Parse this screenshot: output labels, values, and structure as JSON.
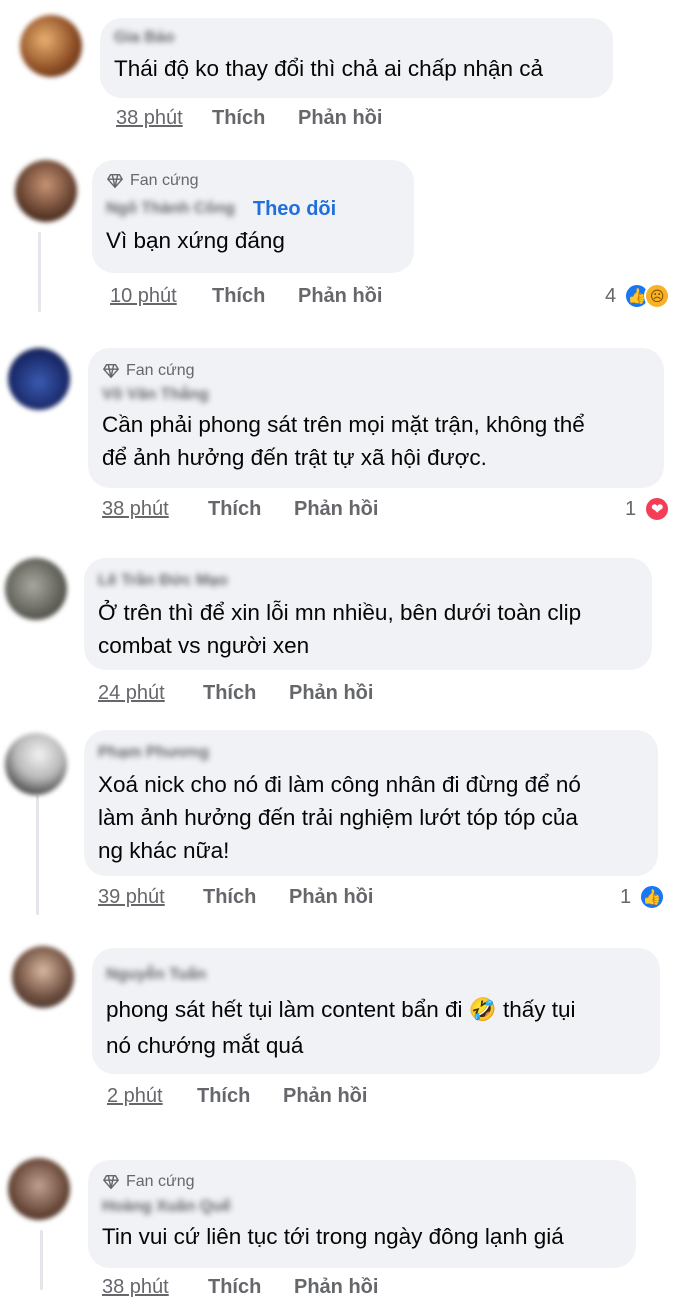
{
  "comments": [
    {
      "name": "Gia Bảo",
      "text_lines": [
        "Thái độ ko thay đổi thì chả ai chấp nhận cả"
      ],
      "time": "38 phút",
      "like": "Thích",
      "reply": "Phản hồi"
    },
    {
      "badge": "Fan cứng",
      "name": "Ngô Thành Công",
      "follow": "Theo dõi",
      "text_lines": [
        "Vì bạn xứng đáng"
      ],
      "time": "10 phút",
      "like": "Thích",
      "reply": "Phản hồi",
      "reaction_count": "4",
      "reaction_icons": [
        "like-icon",
        "sad-icon"
      ]
    },
    {
      "badge": "Fan cứng",
      "name": "Võ Văn Thắng",
      "text_lines": [
        "Cần phải phong sát trên mọi mặt trận, không thể",
        "để ảnh hưởng đến trật tự xã hội được."
      ],
      "time": "38 phút",
      "like": "Thích",
      "reply": "Phản hồi",
      "reaction_count": "1",
      "reaction_icons": [
        "love-icon"
      ]
    },
    {
      "name": "Lê Trần Đức Mạo",
      "text_lines": [
        "Ở trên thì để xin lỗi mn nhiều, bên dưới toàn clip",
        "combat vs người xen"
      ],
      "time": "24 phút",
      "like": "Thích",
      "reply": "Phản hồi"
    },
    {
      "name": "Phạm Phương",
      "text_lines": [
        "Xoá nick cho nó đi làm công nhân đi đừng để nó",
        "làm ảnh hưởng đến trải nghiệm lướt tóp tóp của",
        "ng khác nữa!"
      ],
      "time": "39 phút",
      "like": "Thích",
      "reply": "Phản hồi",
      "reaction_count": "1",
      "reaction_icons": [
        "like-icon"
      ]
    },
    {
      "name": "Nguyễn Tuấn",
      "text_lines": [
        "phong sát hết tụi làm content bẩn đi 🤣 thấy tụi",
        "nó chướng mắt quá"
      ],
      "time": "2 phút",
      "like": "Thích",
      "reply": "Phản hồi"
    },
    {
      "badge": "Fan cứng",
      "name": "Hoàng Xuân Quế",
      "text_lines": [
        "Tin vui cứ liên tục tới trong ngày đông lạnh giá"
      ],
      "time": "38 phút",
      "like": "Thích",
      "reply": "Phản hồi"
    }
  ],
  "colors": {
    "bubble": "#f0f2f5",
    "meta_text": "#65676b",
    "follow_link": "#216fdb",
    "like_reaction": "#1877f2",
    "love_reaction": "#f33e58"
  }
}
